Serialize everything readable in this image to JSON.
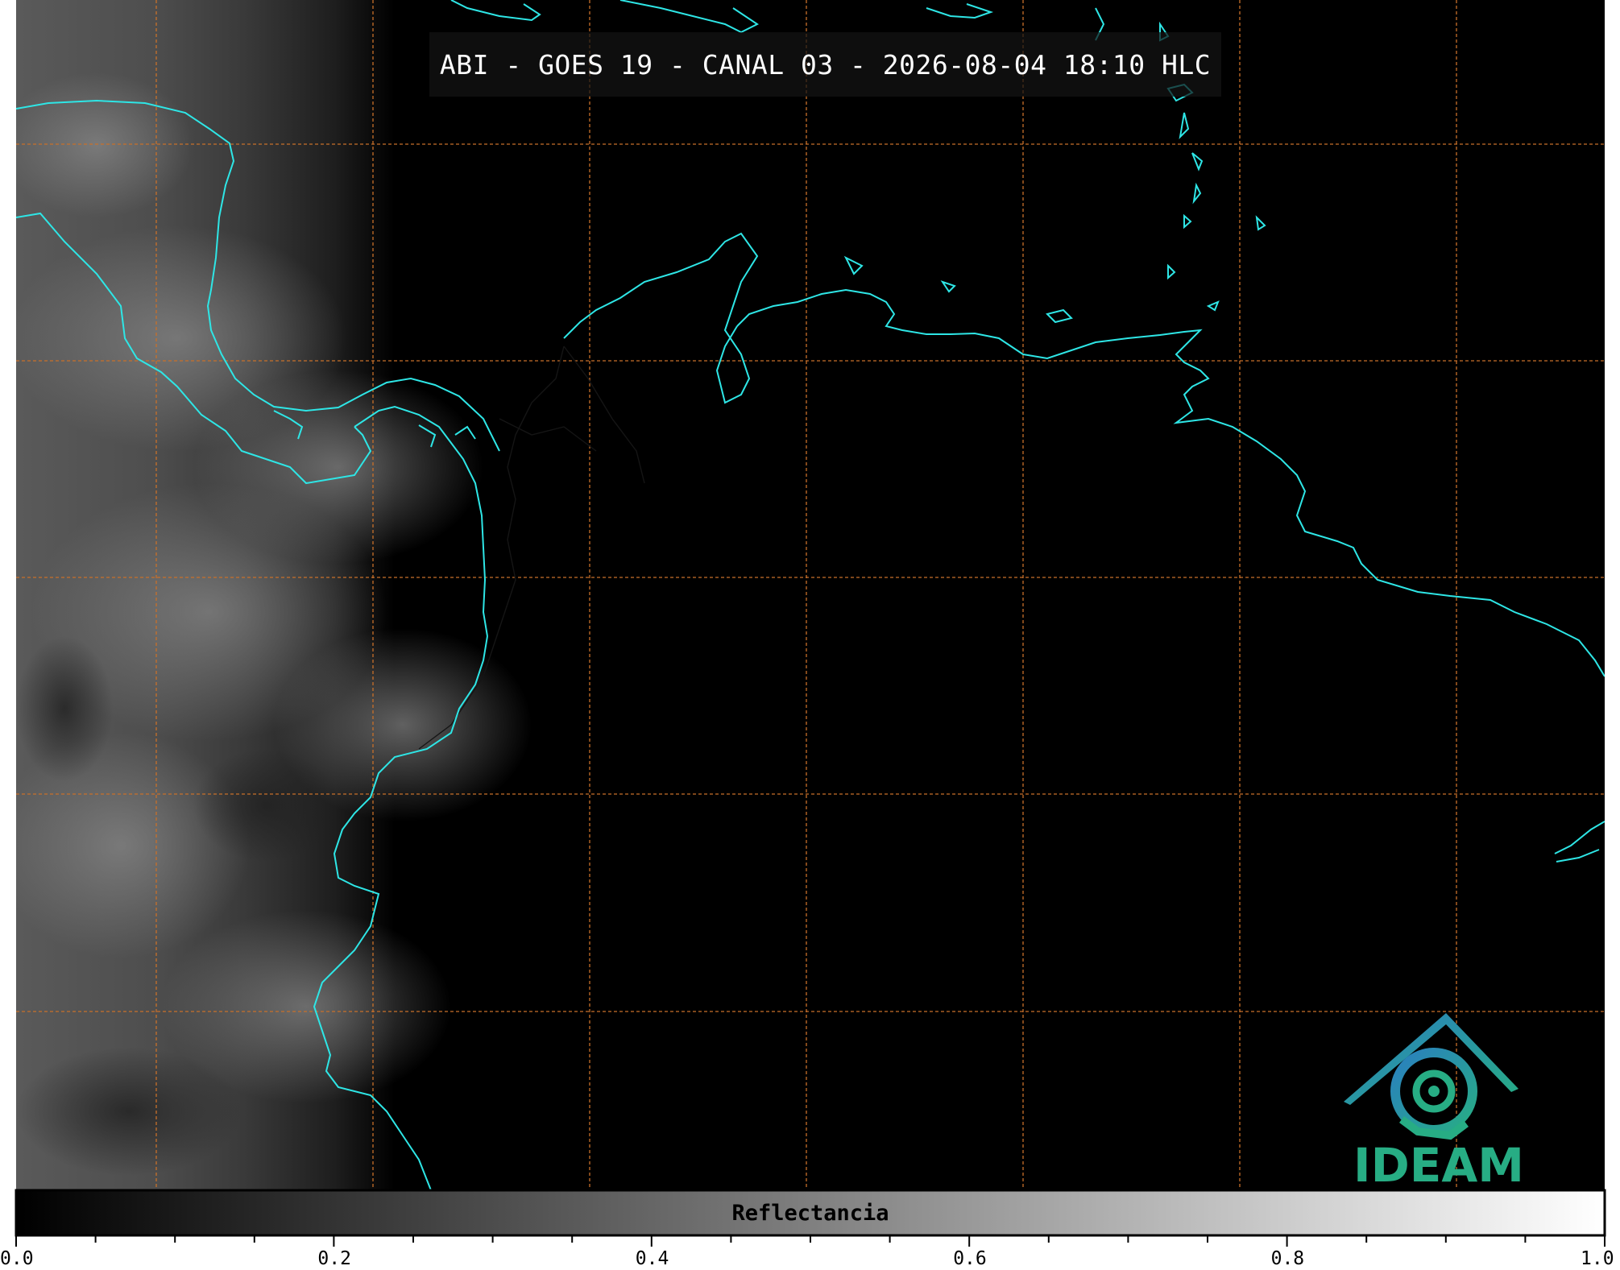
{
  "title": "ABI - GOES 19 - CANAL 03 - 2026-08-04 18:10 HLC",
  "logo": {
    "text": "IDEAM",
    "icon": "ideam-logo-icon"
  },
  "colorbar": {
    "label": "Reflectancia",
    "ticks": [
      "0.0",
      "0.2",
      "0.4",
      "0.6",
      "0.8",
      "1.0"
    ],
    "range": [
      0.0,
      1.0
    ]
  },
  "colors": {
    "coastline": "#2ee6e6",
    "gridline": "#c8702a",
    "logo_green": "#27ad84",
    "logo_blue": "#2a7fc0"
  }
}
